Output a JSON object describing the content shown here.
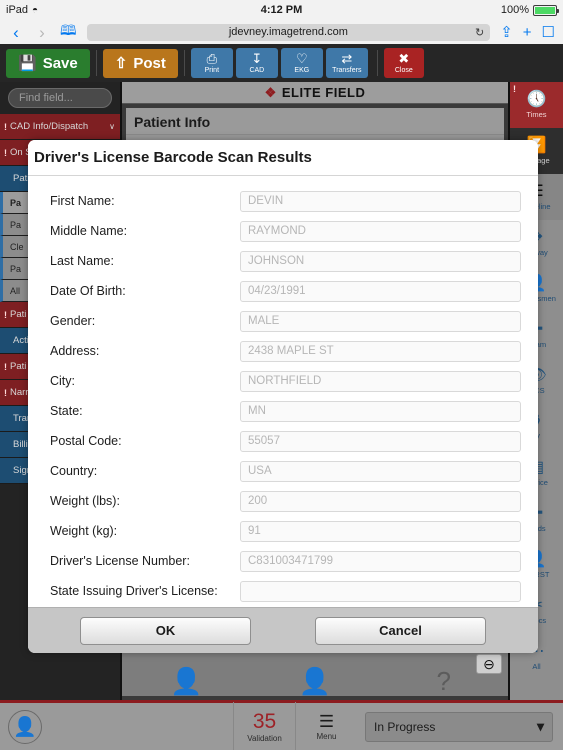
{
  "status_bar": {
    "device": "iPad",
    "wifi_icon": "wifi-icon",
    "time": "4:12 PM",
    "battery_percent": "100%"
  },
  "browser": {
    "back_icon": "chevron-left-icon",
    "forward_icon": "chevron-right-icon",
    "bookmarks_icon": "book-icon",
    "url": "jdevney.imagetrend.com",
    "reload_icon": "reload-icon",
    "share_icon": "share-icon",
    "new_tab_icon": "plus-icon",
    "tabs_icon": "tabs-icon"
  },
  "toolbar": {
    "save_label": "Save",
    "save_icon": "floppy-disk-icon",
    "save_color": "#2a7d2e",
    "post_label": "Post",
    "post_icon": "upload-icon",
    "post_color": "#b9761c",
    "buttons": [
      {
        "label": "Print",
        "icon": "printer-icon"
      },
      {
        "label": "CAD",
        "icon": "download-icon"
      },
      {
        "label": "EKG",
        "icon": "heartbeat-icon"
      },
      {
        "label": "Transfers",
        "icon": "transfer-arrows-icon"
      }
    ],
    "close_label": "Close",
    "close_icon": "x-icon",
    "close_color": "#a92323"
  },
  "left_panel": {
    "find_placeholder": "Find field...",
    "items": [
      {
        "label": "CAD Info/Dispatch",
        "style": "red",
        "alert": "!",
        "chevron": "∨"
      },
      {
        "label": "On S",
        "style": "red",
        "alert": "!",
        "chevron": ""
      },
      {
        "label": "Pati",
        "style": "blue",
        "alert": "",
        "chevron": ""
      }
    ],
    "subrows": [
      "Pa",
      "Pa",
      "Cle",
      "Pa",
      "All"
    ],
    "items_lower": [
      {
        "label": "Acti",
        "style": "blue",
        "alert": ""
      },
      {
        "label": "Pati",
        "style": "red",
        "alert": "!"
      },
      {
        "label": "Narr",
        "style": "red",
        "alert": "!"
      },
      {
        "label": "Tran",
        "style": "blue",
        "alert": ""
      },
      {
        "label": "Billi",
        "style": "blue",
        "alert": ""
      },
      {
        "label": "Sign",
        "style": "blue",
        "alert": ""
      }
    ]
  },
  "center_panel": {
    "app_title": "ELITE FIELD",
    "app_logo_icon": "elite-logo-icon",
    "card_title": "Patient Info",
    "person_icons": [
      "person-icon",
      "person-icon",
      "question-mark-icon"
    ],
    "collapse_icon": "minus-circle-icon"
  },
  "right_panel": {
    "items": [
      {
        "label": "Times",
        "icon": "clock-icon",
        "style": "times",
        "alert": "!"
      },
      {
        "label": "Mileage",
        "icon": "road-icon",
        "style": "dark",
        "alert": ""
      },
      {
        "label": "Timeline",
        "icon": "sliders-icon",
        "style": "shade",
        "alert": ""
      },
      {
        "label": "Airway",
        "icon": "lungs-icon",
        "style": "",
        "alert": ""
      },
      {
        "label": "Assessmen",
        "icon": "person-plus-icon",
        "style": "",
        "alert": ""
      },
      {
        "label": "Exam",
        "icon": "medical-bag-icon",
        "style": "",
        "alert": ""
      },
      {
        "label": "GCS",
        "icon": "eye-icon",
        "style": "",
        "alert": ""
      },
      {
        "label": "IV",
        "icon": "iv-drip-icon",
        "style": "",
        "alert": ""
      },
      {
        "label": "Device",
        "icon": "monitor-icon",
        "style": "",
        "alert": ""
      },
      {
        "label": "Meds",
        "icon": "medkit-icon",
        "style": "",
        "alert": ""
      },
      {
        "label": "CHRST",
        "icon": "body-icon",
        "style": "",
        "alert": ""
      },
      {
        "label": "Procs",
        "icon": "scissors-icon",
        "style": "",
        "alert": ""
      },
      {
        "label": "All",
        "icon": "ellipsis-icon",
        "style": "",
        "alert": ""
      }
    ]
  },
  "bottom_bar": {
    "avatar_icon": "user-icon",
    "validation_count": "35",
    "validation_label": "Validation",
    "menu_icon": "list-icon",
    "menu_label": "Menu",
    "status_value": "In Progress",
    "status_chevron_icon": "chevron-down-icon"
  },
  "modal": {
    "title": "Driver's License Barcode Scan Results",
    "fields": [
      {
        "label": "First Name:",
        "value": "DEVIN"
      },
      {
        "label": "Middle Name:",
        "value": "RAYMOND"
      },
      {
        "label": "Last Name:",
        "value": "JOHNSON"
      },
      {
        "label": "Date Of Birth:",
        "value": "04/23/1991"
      },
      {
        "label": "Gender:",
        "value": "MALE"
      },
      {
        "label": "Address:",
        "value": "2438 MAPLE ST"
      },
      {
        "label": "City:",
        "value": "NORTHFIELD"
      },
      {
        "label": "State:",
        "value": "MN"
      },
      {
        "label": "Postal Code:",
        "value": "55057"
      },
      {
        "label": "Country:",
        "value": "USA"
      },
      {
        "label": "Weight (lbs):",
        "value": "200"
      },
      {
        "label": "Weight (kg):",
        "value": "91"
      },
      {
        "label": "Driver's License Number:",
        "value": "C831003471799"
      },
      {
        "label": "State Issuing Driver's License:",
        "value": ""
      }
    ],
    "ok_label": "OK",
    "cancel_label": "Cancel"
  }
}
